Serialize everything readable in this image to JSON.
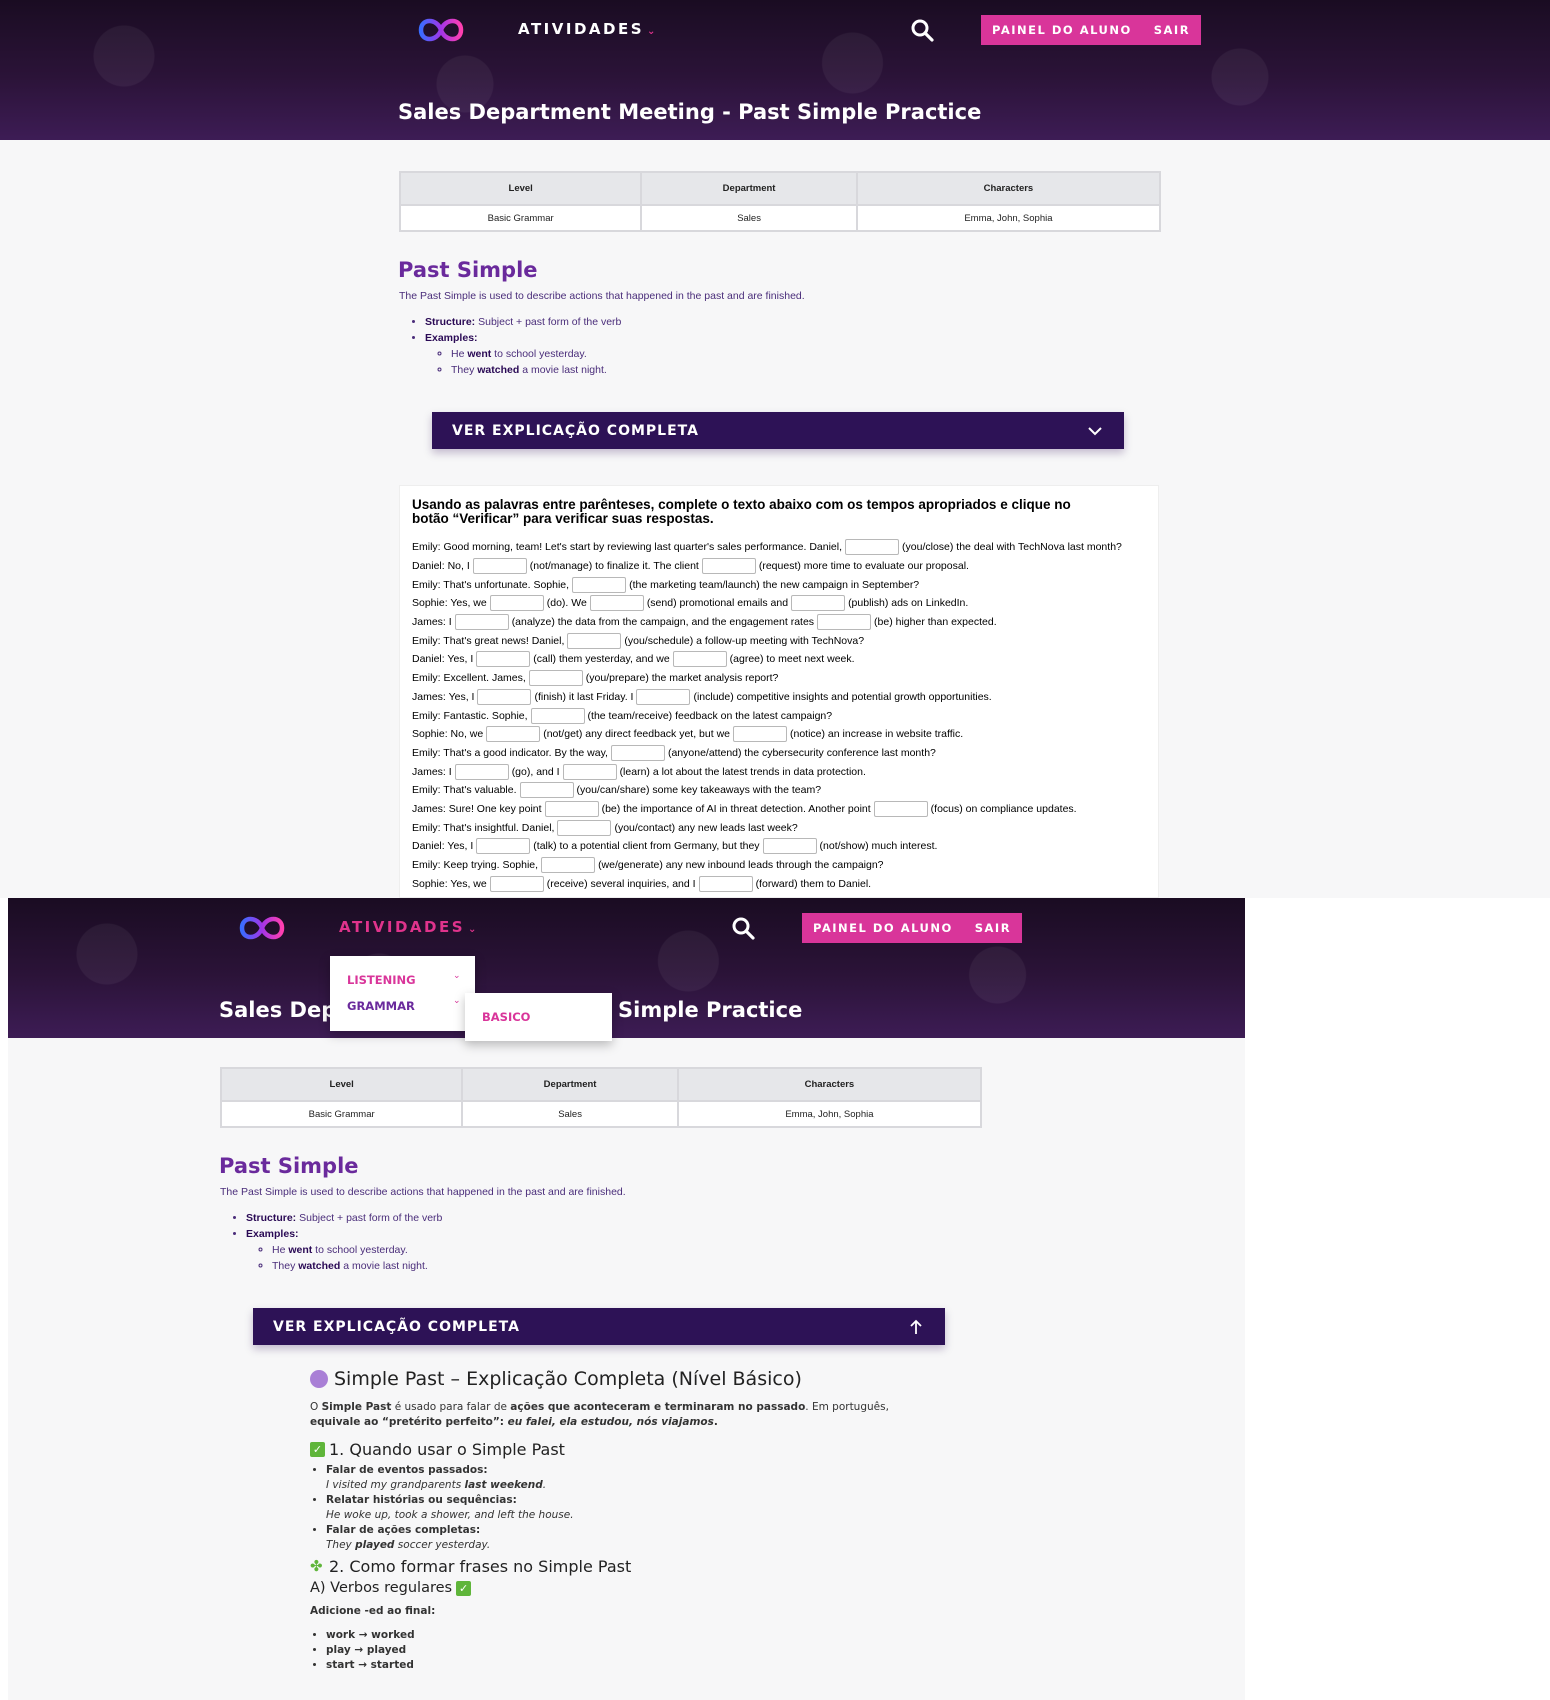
{
  "header": {
    "nav_label": "ATIVIDADES",
    "caret": "⌄",
    "painel_label": "PAINEL DO ALUNO",
    "sair_label": "SAIR",
    "page_title": "Sales Department Meeting - Past Simple Practice"
  },
  "info_table": {
    "headers": [
      "Level",
      "Department",
      "Characters"
    ],
    "values": [
      "Basic Grammar",
      "Sales",
      "Emma, John, Sophia"
    ]
  },
  "past_simple": {
    "title": "Past Simple",
    "description": "The Past Simple is used to describe actions that happened in the past and are finished.",
    "structure_label": "Structure:",
    "structure_text": " Subject + past form of the verb",
    "examples_label": "Examples:",
    "ex1_a": "He ",
    "ex1_b": "went",
    "ex1_c": " to school yesterday.",
    "ex2_a": "They ",
    "ex2_b": "watched",
    "ex2_c": " a movie last night."
  },
  "accordion": {
    "label": "VER EXPLICAÇÃO COMPLETA"
  },
  "exercise": {
    "instructions": "Usando as palavras entre parênteses, complete o texto abaixo com os tempos apropriados e clique no botão “Verificar” para verificar suas respostas.",
    "lines": [
      [
        "Emily: Good morning, team! Let's start by reviewing last quarter's sales performance. Daniel,",
        "(you/close) the deal with TechNova last month?"
      ],
      [
        "Daniel: No, I",
        "(not/manage) to finalize it. The client",
        "(request) more time to evaluate our proposal."
      ],
      [
        "Emily: That's unfortunate. Sophie,",
        "(the marketing team/launch) the new campaign in September?"
      ],
      [
        "Sophie: Yes, we",
        "(do). We",
        "(send) promotional emails and",
        "(publish) ads on LinkedIn."
      ],
      [
        "James: I",
        "(analyze) the data from the campaign, and the engagement rates",
        "(be) higher than expected."
      ],
      [
        "Emily: That's great news! Daniel,",
        "(you/schedule) a follow-up meeting with TechNova?"
      ],
      [
        "Daniel: Yes, I",
        "(call) them yesterday, and we",
        "(agree) to meet next week."
      ],
      [
        "Emily: Excellent. James,",
        "(you/prepare) the market analysis report?"
      ],
      [
        "James: Yes, I",
        "(finish) it last Friday. I",
        "(include) competitive insights and potential growth opportunities."
      ],
      [
        "Emily: Fantastic. Sophie,",
        "(the team/receive) feedback on the latest campaign?"
      ],
      [
        "Sophie: No, we",
        "(not/get) any direct feedback yet, but we",
        "(notice) an increase in website traffic."
      ],
      [
        "Emily: That's a good indicator. By the way,",
        "(anyone/attend) the cybersecurity conference last month?"
      ],
      [
        "James: I",
        "(go), and I",
        "(learn) a lot about the latest trends in data protection."
      ],
      [
        "Emily: That's valuable.",
        "(you/can/share) some key takeaways with the team?"
      ],
      [
        "James: Sure! One key point",
        "(be) the importance of AI in threat detection. Another point",
        "(focus) on compliance updates."
      ],
      [
        "Emily: That's insightful. Daniel,",
        "(you/contact) any new leads last week?"
      ],
      [
        "Daniel: Yes, I",
        "(talk) to a potential client from Germany, but they",
        "(not/show) much interest."
      ],
      [
        "Emily: Keep trying. Sophie,",
        "(we/generate) any new inbound leads through the campaign?"
      ],
      [
        "Sophie: Yes, we",
        "(receive) several inquiries, and I",
        "(forward) them to Daniel."
      ]
    ]
  },
  "dropdown": {
    "listening": "LISTENING",
    "grammar": "GRAMMAR",
    "basico": "BASICO"
  },
  "explanation": {
    "title": "Simple Past – Explicação Completa (Nível Básico)",
    "intro_1": "O ",
    "intro_b1": "Simple Past",
    "intro_2": " é usado para falar de ",
    "intro_b2": "ações que aconteceram e terminaram no passado",
    "intro_3": ". Em português,",
    "intro_line2_a": "equivale ao “pretérito perfeito”: ",
    "intro_line2_i": "eu falei, ela estudou, nós viajamos",
    "h2_1": "1. Quando usar o Simple Past",
    "use1": "Falar de eventos passados:",
    "use1_ex_a": "I visited my grandparents ",
    "use1_ex_b": "last weekend",
    "use1_ex_c": ".",
    "use2": "Relatar histórias ou sequências:",
    "use2_ex": "He woke up, took a shower, and left the house.",
    "use3": "Falar de ações completas:",
    "use3_ex_a": "They ",
    "use3_ex_b": "played",
    "use3_ex_c": " soccer yesterday.",
    "h2_2": "2. Como formar frases no Simple Past",
    "h3_1": "A) Verbos regulares",
    "add_ed": "Adicione -ed ao final:",
    "reg1": "work → worked",
    "reg2": "play → played",
    "reg3": "start → started"
  },
  "colors": {
    "brand_pink": "#d9359a",
    "accordion_bg": "#2d1256",
    "title_purple": "#6a2a9c"
  }
}
